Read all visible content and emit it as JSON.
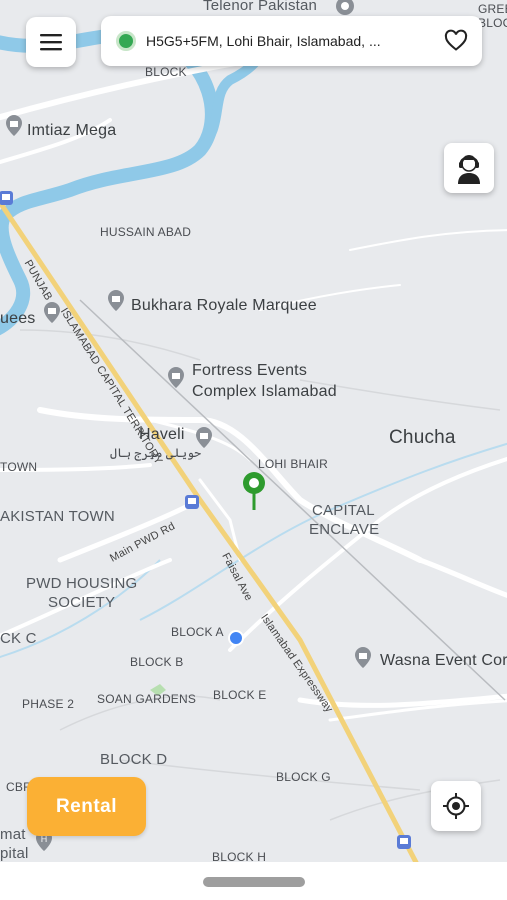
{
  "search": {
    "address": "H5G5+5FM, Lohi Bhair, Islamabad, ..."
  },
  "rental_button": {
    "label": "Rental"
  },
  "map": {
    "labels": {
      "telenor": "Telenor Pakistan",
      "gree_top": "GREE",
      "bloc_top": "BLOC",
      "block_top": "BLOCK",
      "imtiaz": "Imtiaz Mega",
      "hussain_abad": "HUSSAIN ABAD",
      "bukhara": "Bukhara Royale Marquee",
      "quees": "uees",
      "punjab_road": "PUNJAB",
      "islamabad_capital_territory": "ISLAMABAD CAPITAL TERRITORY",
      "fortress_line1": "Fortress Events",
      "fortress_line2": "Complex Islamabad",
      "haveli": "Haveli",
      "haveli_urdu": "حویلی میرج ہال",
      "chucha": "Chucha",
      "lohi_bhair": "LOHI BHAIR",
      "town": "TOWN",
      "capital_enclave_1": "CAPITAL",
      "capital_enclave_2": "ENCLAVE",
      "pakistan_town": "AKISTAN TOWN",
      "main_pwd_rd": "Main PWD Rd",
      "faisal_ave": "Faisal Ave",
      "pwd_housing_1": "PWD HOUSING",
      "pwd_housing_2": "SOCIETY",
      "block_c": "CK C",
      "block_a": "BLOCK A",
      "islamabad_expressway": "Islamabad Expressway",
      "wasna": "Wasna Event Cor",
      "block_b": "BLOCK B",
      "phase_2": "PHASE 2",
      "soan_gardens": "SOAN GARDENS",
      "block_e": "BLOCK E",
      "block_d": "BLOCK D",
      "block_g": "BLOCK G",
      "cbr": "CBR",
      "mat": "mat",
      "pital": "pital",
      "block_h": "BLOCK H"
    }
  },
  "colors": {
    "accent": "#fbb034",
    "pin": "#2e9b2e",
    "user_dot": "#4285f4",
    "water": "#8fc9e8",
    "highway": "#f2d27a"
  }
}
